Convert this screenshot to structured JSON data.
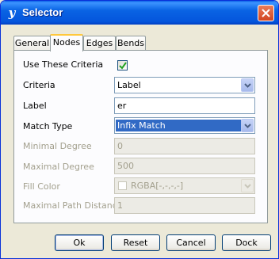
{
  "window": {
    "title": "Selector",
    "app_icon": "yfiles-logo-icon",
    "close_icon": "close-icon"
  },
  "tabs": [
    {
      "label": "General",
      "active": false
    },
    {
      "label": "Nodes",
      "active": true
    },
    {
      "label": "Edges",
      "active": false
    },
    {
      "label": "Bends",
      "active": false
    }
  ],
  "form": {
    "use_criteria": {
      "label": "Use These Criteria",
      "checked": true
    },
    "criteria": {
      "label": "Criteria",
      "value": "Label"
    },
    "label": {
      "label": "Label",
      "value": "er"
    },
    "match_type": {
      "label": "Match Type",
      "value": "Infix Match"
    },
    "minimal_degree": {
      "label": "Minimal Degree",
      "value": "0",
      "enabled": false
    },
    "maximal_degree": {
      "label": "Maximal Degree",
      "value": "500",
      "enabled": false
    },
    "fill_color": {
      "label": "Fill Color",
      "value": "RGBA[-,-,-,-]",
      "enabled": false
    },
    "maximal_path_distance": {
      "label": "Maximal Path Distance",
      "value": "1",
      "enabled": false
    }
  },
  "buttons": {
    "ok": "Ok",
    "reset": "Reset",
    "cancel": "Cancel",
    "dock": "Dock"
  },
  "colors": {
    "titlebar": "#0455dc",
    "selection": "#316ac5",
    "active_tab_accent": "#ffc83c",
    "checkmark": "#21a121"
  }
}
